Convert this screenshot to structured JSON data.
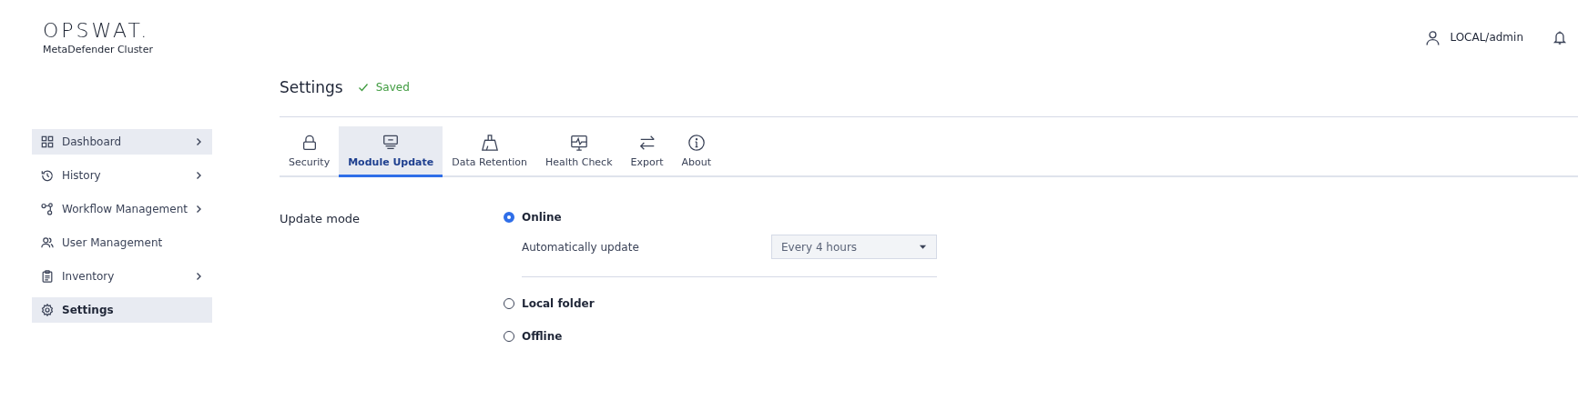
{
  "brand": {
    "logo": "OPSWAT.",
    "product": "MetaDefender Cluster"
  },
  "header": {
    "user": "LOCAL/admin"
  },
  "sidebar": {
    "items": [
      {
        "label": "Dashboard",
        "selected": false,
        "hovered": true,
        "expandable": true
      },
      {
        "label": "History",
        "selected": false,
        "hovered": false,
        "expandable": true
      },
      {
        "label": "Workflow Management",
        "selected": false,
        "hovered": false,
        "expandable": true
      },
      {
        "label": "User Management",
        "selected": false,
        "hovered": false,
        "expandable": false
      },
      {
        "label": "Inventory",
        "selected": false,
        "hovered": false,
        "expandable": true
      },
      {
        "label": "Settings",
        "selected": true,
        "hovered": false,
        "expandable": false
      }
    ]
  },
  "page": {
    "title": "Settings",
    "status": "Saved"
  },
  "tabs": [
    {
      "label": "Security",
      "selected": false
    },
    {
      "label": "Module Update",
      "selected": true
    },
    {
      "label": "Data Retention",
      "selected": false
    },
    {
      "label": "Health Check",
      "selected": false
    },
    {
      "label": "Export",
      "selected": false
    },
    {
      "label": "About",
      "selected": false
    }
  ],
  "update_mode": {
    "label": "Update mode",
    "options": [
      {
        "label": "Online",
        "selected": true,
        "setting": {
          "label": "Automatically update",
          "value": "Every 4 hours"
        }
      },
      {
        "label": "Local folder",
        "selected": false
      },
      {
        "label": "Offline",
        "selected": false
      }
    ]
  }
}
